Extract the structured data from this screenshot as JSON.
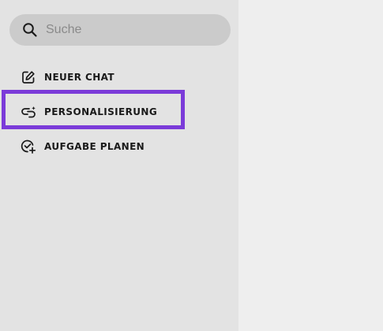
{
  "search": {
    "placeholder": "Suche",
    "value": "",
    "icon": "search-icon"
  },
  "nav": {
    "items": [
      {
        "label": "NEUER CHAT",
        "icon": "edit-icon"
      },
      {
        "label": "PERSONALISIERUNG",
        "icon": "personalization-icon"
      },
      {
        "label": "AUFGABE PLANEN",
        "icon": "schedule-task-icon"
      }
    ]
  },
  "colors": {
    "sidebar_bg": "#e3e3e3",
    "search_bg": "#cbcbcb",
    "main_bg": "#eeeeee",
    "highlight": "#7b3bd9"
  }
}
